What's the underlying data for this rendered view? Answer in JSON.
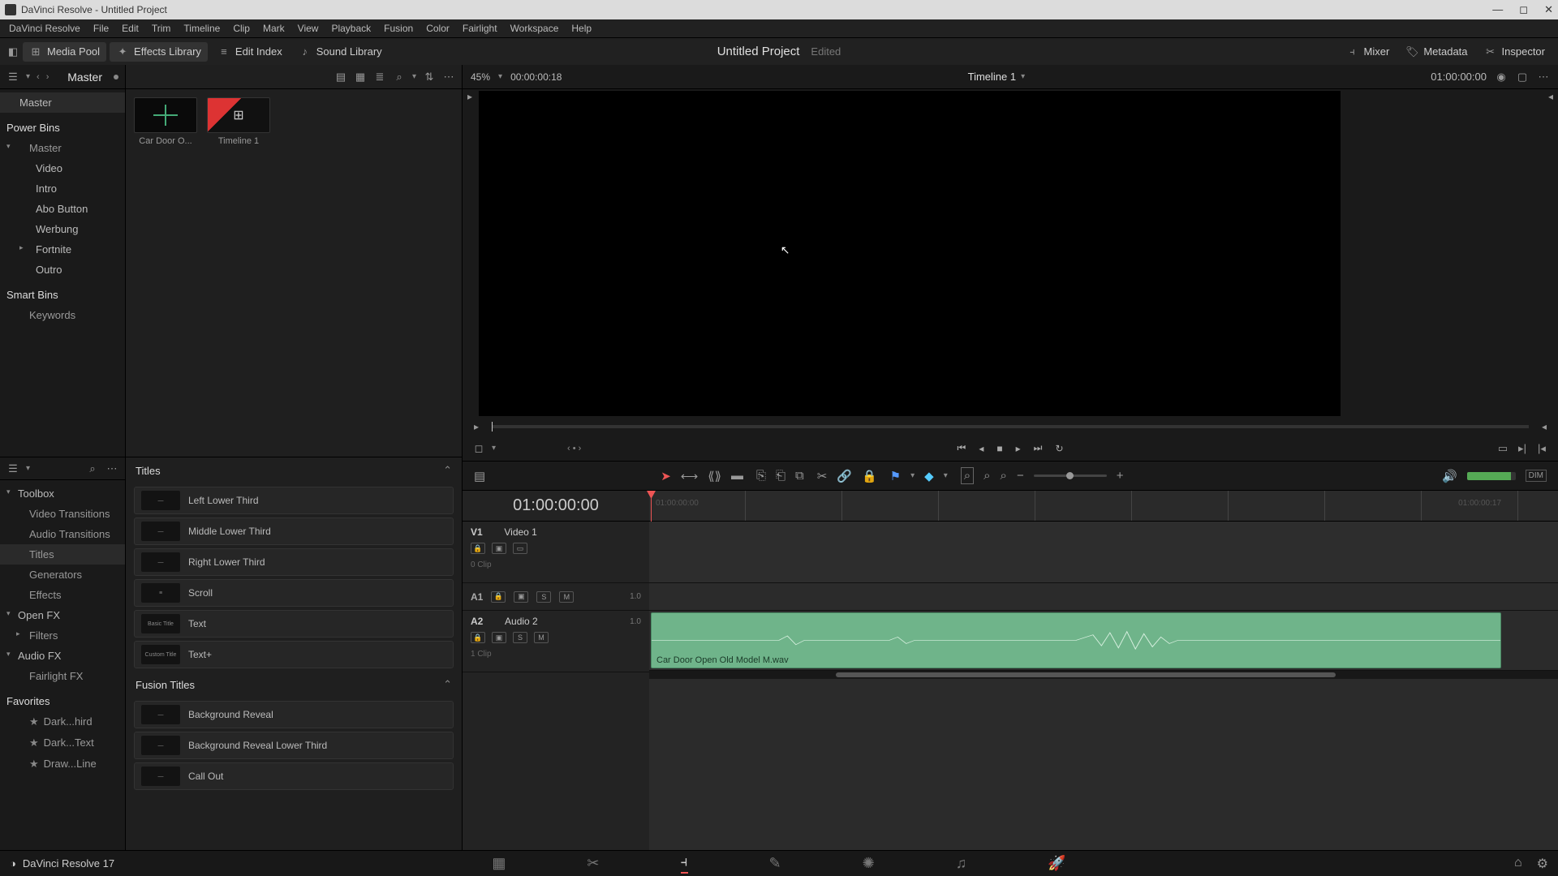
{
  "titlebar": {
    "text": "DaVinci Resolve - Untitled Project"
  },
  "menu": [
    "DaVinci Resolve",
    "File",
    "Edit",
    "Trim",
    "Timeline",
    "Clip",
    "Mark",
    "View",
    "Playback",
    "Fusion",
    "Color",
    "Fairlight",
    "Workspace",
    "Help"
  ],
  "toolbar": {
    "left": [
      {
        "name": "media-pool-button",
        "icon": "⊞",
        "label": "Media Pool",
        "active": true
      },
      {
        "name": "effects-library-button",
        "icon": "✦",
        "label": "Effects Library",
        "active": true
      },
      {
        "name": "edit-index-button",
        "icon": "≡",
        "label": "Edit Index",
        "active": false
      },
      {
        "name": "sound-library-button",
        "icon": "♪",
        "label": "Sound Library",
        "active": false
      }
    ],
    "project": "Untitled Project",
    "edited": "Edited",
    "right": [
      {
        "name": "mixer-button",
        "icon": "⫞",
        "label": "Mixer"
      },
      {
        "name": "metadata-button",
        "icon": "🏷",
        "label": "Metadata"
      },
      {
        "name": "inspector-button",
        "icon": "✂",
        "label": "Inspector"
      }
    ]
  },
  "mediaPool": {
    "bin": "Master",
    "rootLabel": "Master",
    "powerBinsHdr": "Power Bins",
    "powerBins": [
      "Master",
      "Video",
      "Intro",
      "Abo Button",
      "Werbung",
      "Fortnite",
      "Outro"
    ],
    "smartBinsHdr": "Smart Bins",
    "smartBins": [
      "Keywords"
    ],
    "clips": [
      {
        "name": "Car Door O...",
        "kind": "audio"
      },
      {
        "name": "Timeline 1",
        "kind": "timeline"
      }
    ]
  },
  "viewer": {
    "zoom": "45%",
    "srcTC": "00:00:00:18",
    "title": "Timeline 1",
    "recTC": "01:00:00:00"
  },
  "fxTree": {
    "toolbox": "Toolbox",
    "items": [
      "Video Transitions",
      "Audio Transitions",
      "Titles",
      "Generators",
      "Effects"
    ],
    "openfx": "Open FX",
    "openfxItems": [
      "Filters"
    ],
    "audiofx": "Audio FX",
    "audiofxItems": [
      "Fairlight FX"
    ],
    "favHdr": "Favorites",
    "favs": [
      "Dark...hird",
      "Dark...Text",
      "Draw...Line"
    ]
  },
  "titlesPanel": {
    "hdr1": "Titles",
    "list1": [
      "Left Lower Third",
      "Middle Lower Third",
      "Right Lower Third",
      "Scroll",
      "Text",
      "Text+"
    ],
    "prev1": [
      "—",
      "—",
      "—",
      "≡",
      "Basic Title",
      "Custom Title"
    ],
    "hdr2": "Fusion Titles",
    "list2": [
      "Background Reveal",
      "Background Reveal Lower Third",
      "Call Out"
    ]
  },
  "timeline": {
    "tc": "01:00:00:00",
    "endTC": "01:00:00:17",
    "tracks": {
      "v1": {
        "id": "V1",
        "name": "Video 1",
        "clipCount": "0 Clip"
      },
      "a1": {
        "id": "A1",
        "name": "",
        "ch": "1.0"
      },
      "a2": {
        "id": "A2",
        "name": "Audio 2",
        "ch": "1.0",
        "clipLabel": "Car Door Open Old Model M.wav",
        "clipCount": "1 Clip"
      }
    }
  },
  "appVersion": "DaVinci Resolve 17"
}
